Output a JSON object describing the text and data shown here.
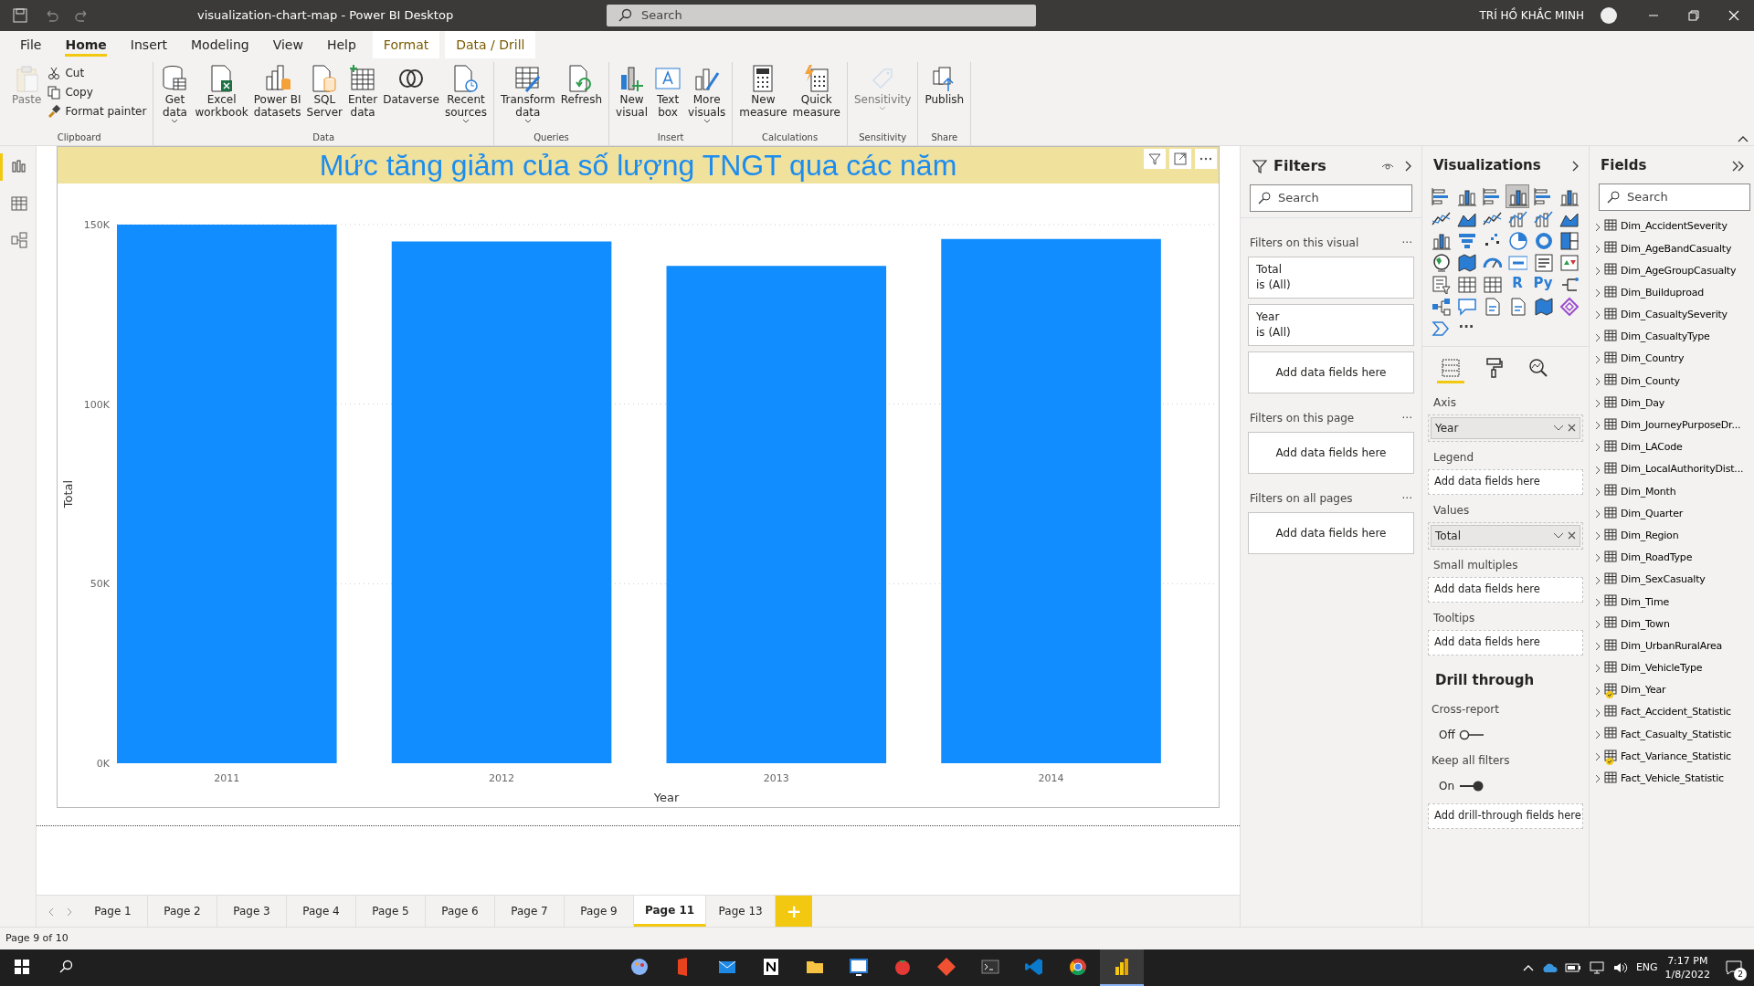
{
  "window": {
    "title": "visualization-chart-map - Power BI Desktop",
    "search_placeholder": "Search",
    "user": "TRÍ HỒ KHẮC MINH"
  },
  "menu_tabs": [
    {
      "label": "File",
      "selected": false,
      "kind": "normal"
    },
    {
      "label": "Home",
      "selected": true,
      "kind": "normal"
    },
    {
      "label": "Insert",
      "selected": false,
      "kind": "normal"
    },
    {
      "label": "Modeling",
      "selected": false,
      "kind": "normal"
    },
    {
      "label": "View",
      "selected": false,
      "kind": "normal"
    },
    {
      "label": "Help",
      "selected": false,
      "kind": "normal"
    },
    {
      "label": "Format",
      "selected": false,
      "kind": "contextual"
    },
    {
      "label": "Data / Drill",
      "selected": false,
      "kind": "contextual"
    }
  ],
  "ribbon": [
    {
      "label": "Clipboard",
      "buttons": [
        {
          "label": "Paste",
          "kind": "large",
          "disabled": true,
          "dropdown": false
        },
        {
          "label": "Cut",
          "kind": "small"
        },
        {
          "label": "Copy",
          "kind": "small"
        },
        {
          "label": "Format painter",
          "kind": "small"
        }
      ]
    },
    {
      "label": "Data",
      "buttons": [
        {
          "label": "Get\ndata",
          "kind": "large",
          "disabled": false,
          "dropdown": true
        },
        {
          "label": "Excel\nworkbook",
          "kind": "large",
          "disabled": false,
          "dropdown": false
        },
        {
          "label": "Power BI\ndatasets",
          "kind": "large",
          "disabled": false,
          "dropdown": false
        },
        {
          "label": "SQL\nServer",
          "kind": "large",
          "disabled": false,
          "dropdown": false
        },
        {
          "label": "Enter\ndata",
          "kind": "large",
          "disabled": false,
          "dropdown": false
        },
        {
          "label": "Dataverse",
          "kind": "large",
          "disabled": false,
          "dropdown": false
        },
        {
          "label": "Recent\nsources",
          "kind": "large",
          "disabled": false,
          "dropdown": true
        }
      ]
    },
    {
      "label": "Queries",
      "buttons": [
        {
          "label": "Transform\ndata",
          "kind": "large",
          "disabled": false,
          "dropdown": true
        },
        {
          "label": "Refresh",
          "kind": "large",
          "disabled": false,
          "dropdown": false
        }
      ]
    },
    {
      "label": "Insert",
      "buttons": [
        {
          "label": "New\nvisual",
          "kind": "large",
          "disabled": false,
          "dropdown": false
        },
        {
          "label": "Text\nbox",
          "kind": "large",
          "disabled": false,
          "dropdown": false
        },
        {
          "label": "More\nvisuals",
          "kind": "large",
          "disabled": false,
          "dropdown": true
        }
      ]
    },
    {
      "label": "Calculations",
      "buttons": [
        {
          "label": "New\nmeasure",
          "kind": "large",
          "disabled": false,
          "dropdown": false
        },
        {
          "label": "Quick\nmeasure",
          "kind": "large",
          "disabled": false,
          "dropdown": false
        }
      ]
    },
    {
      "label": "Sensitivity",
      "buttons": [
        {
          "label": "Sensitivity",
          "kind": "large",
          "disabled": true,
          "dropdown": true
        }
      ]
    },
    {
      "label": "Share",
      "buttons": [
        {
          "label": "Publish",
          "kind": "large",
          "disabled": false,
          "dropdown": false
        }
      ]
    }
  ],
  "left_rail": [
    {
      "selected": true
    },
    {
      "selected": false
    },
    {
      "selected": false
    }
  ],
  "visual": {
    "chart_data": {
      "type": "bar",
      "title": "Mức tăng giảm của số lượng TNGT qua các năm",
      "xlabel": "Year",
      "ylabel": "Total",
      "categories": [
        "2011",
        "2012",
        "2013",
        "2014"
      ],
      "values": [
        150000,
        145300,
        138500,
        146000
      ],
      "ylim": [
        0,
        150000
      ],
      "grid": true,
      "yticks": [
        {
          "value": 0,
          "label": "0K"
        },
        {
          "value": 50000,
          "label": "50K"
        },
        {
          "value": 100000,
          "label": "100K"
        },
        {
          "value": 150000,
          "label": "150K"
        }
      ],
      "color": "#118dff"
    }
  },
  "pages": [
    {
      "label": "Page 1",
      "selected": false
    },
    {
      "label": "Page 2",
      "selected": false
    },
    {
      "label": "Page 3",
      "selected": false
    },
    {
      "label": "Page 4",
      "selected": false
    },
    {
      "label": "Page 5",
      "selected": false
    },
    {
      "label": "Page 6",
      "selected": false
    },
    {
      "label": "Page 7",
      "selected": false
    },
    {
      "label": "Page 9",
      "selected": false
    },
    {
      "label": "Page 11",
      "selected": true
    },
    {
      "label": "Page 13",
      "selected": false
    }
  ],
  "add_page": "+",
  "status_bar": "Page 9 of 10",
  "filters": {
    "title": "Filters",
    "search_placeholder": "Search",
    "sections": [
      {
        "title": "Filters on this visual",
        "menu": "···",
        "cards": [
          {
            "name": "Total",
            "state": "is (All)"
          },
          {
            "name": "Year",
            "state": "is (All)"
          }
        ],
        "drop_text": "Add data fields here"
      },
      {
        "title": "Filters on this page",
        "menu": "···",
        "drop_text": "Add data fields here"
      },
      {
        "title": "Filters on all pages",
        "menu": "···",
        "drop_text": "Add data fields here"
      }
    ]
  },
  "visualizations": {
    "title": "Visualizations",
    "gallery": [
      {
        "kind": "icon",
        "selected": false
      },
      {
        "kind": "icon",
        "selected": false
      },
      {
        "kind": "icon",
        "selected": false
      },
      {
        "kind": "icon",
        "selected": true
      },
      {
        "kind": "icon",
        "selected": false
      },
      {
        "kind": "icon",
        "selected": false
      },
      {
        "kind": "icon",
        "selected": false
      },
      {
        "kind": "icon",
        "selected": false
      },
      {
        "kind": "icon",
        "selected": false
      },
      {
        "kind": "icon",
        "selected": false
      },
      {
        "kind": "icon",
        "selected": false
      },
      {
        "kind": "icon",
        "selected": false
      },
      {
        "kind": "icon",
        "selected": false
      },
      {
        "kind": "icon",
        "selected": false
      },
      {
        "kind": "icon",
        "selected": false
      },
      {
        "kind": "icon",
        "selected": false
      },
      {
        "kind": "icon",
        "selected": false
      },
      {
        "kind": "icon",
        "selected": false
      },
      {
        "kind": "icon",
        "selected": false
      },
      {
        "kind": "icon",
        "selected": false
      },
      {
        "kind": "icon",
        "selected": false
      },
      {
        "kind": "icon",
        "selected": false
      },
      {
        "kind": "icon",
        "selected": false
      },
      {
        "kind": "icon",
        "selected": false
      },
      {
        "kind": "icon",
        "selected": false
      },
      {
        "kind": "icon",
        "selected": false
      },
      {
        "kind": "icon",
        "selected": false
      },
      {
        "kind": "text",
        "label": "R",
        "selected": false
      },
      {
        "kind": "text",
        "label": "Py",
        "selected": false
      },
      {
        "kind": "icon",
        "selected": false
      },
      {
        "kind": "icon",
        "selected": false
      },
      {
        "kind": "icon",
        "selected": false
      },
      {
        "kind": "icon",
        "selected": false
      },
      {
        "kind": "icon",
        "selected": false
      },
      {
        "kind": "icon",
        "selected": false
      },
      {
        "kind": "icon",
        "selected": false
      },
      {
        "kind": "icon",
        "selected": false
      },
      {
        "kind": "more",
        "label": "···",
        "selected": false
      }
    ],
    "pane_tabs": [
      {
        "selected": true
      },
      {
        "selected": false
      },
      {
        "selected": false
      }
    ],
    "wells": [
      {
        "label": "Axis",
        "field": "Year"
      },
      {
        "label": "Legend",
        "drop_text": "Add data fields here"
      },
      {
        "label": "Values",
        "field": "Total"
      },
      {
        "label": "Small multiples",
        "drop_text": "Add data fields here"
      },
      {
        "label": "Tooltips",
        "drop_text": "Add data fields here"
      }
    ],
    "drill_through": {
      "title": "Drill through",
      "toggles": [
        {
          "label": "Cross-report",
          "state_text": "Off",
          "on": false
        },
        {
          "label": "Keep all filters",
          "state_text": "On",
          "on": true
        }
      ],
      "drop_text": "Add drill-through fields here"
    }
  },
  "fields": {
    "title": "Fields",
    "search_placeholder": "Search",
    "tables": [
      {
        "name": "Dim_AccidentSeverity",
        "used": false
      },
      {
        "name": "Dim_AgeBandCasualty",
        "used": false
      },
      {
        "name": "Dim_AgeGroupCasualty",
        "used": false
      },
      {
        "name": "Dim_Builduproad",
        "used": false
      },
      {
        "name": "Dim_CasualtySeverity",
        "used": false
      },
      {
        "name": "Dim_CasualtyType",
        "used": false
      },
      {
        "name": "Dim_Country",
        "used": false
      },
      {
        "name": "Dim_County",
        "used": false
      },
      {
        "name": "Dim_Day",
        "used": false
      },
      {
        "name": "Dim_JourneyPurposeDr...",
        "used": false
      },
      {
        "name": "Dim_LACode",
        "used": false
      },
      {
        "name": "Dim_LocalAuthorityDist...",
        "used": false
      },
      {
        "name": "Dim_Month",
        "used": false
      },
      {
        "name": "Dim_Quarter",
        "used": false
      },
      {
        "name": "Dim_Region",
        "used": false
      },
      {
        "name": "Dim_RoadType",
        "used": false
      },
      {
        "name": "Dim_SexCasualty",
        "used": false
      },
      {
        "name": "Dim_Time",
        "used": false
      },
      {
        "name": "Dim_Town",
        "used": false
      },
      {
        "name": "Dim_UrbanRuralArea",
        "used": false
      },
      {
        "name": "Dim_VehicleType",
        "used": false
      },
      {
        "name": "Dim_Year",
        "used": true
      },
      {
        "name": "Fact_Accident_Statistic",
        "used": false
      },
      {
        "name": "Fact_Casualty_Statistic",
        "used": false
      },
      {
        "name": "Fact_Variance_Statistic",
        "used": true
      },
      {
        "name": "Fact_Vehicle_Statistic",
        "used": false
      }
    ]
  },
  "taskbar": {
    "apps": [
      {
        "selected": false
      },
      {
        "selected": false
      },
      {
        "selected": false
      },
      {
        "selected": false
      },
      {
        "selected": false
      },
      {
        "selected": false
      },
      {
        "selected": false
      },
      {
        "selected": false
      },
      {
        "selected": false
      },
      {
        "selected": false
      },
      {
        "selected": false
      },
      {
        "selected": true
      }
    ],
    "language": "ENG",
    "time": "7:17 PM",
    "date": "1/8/2022",
    "notifications": "2"
  }
}
